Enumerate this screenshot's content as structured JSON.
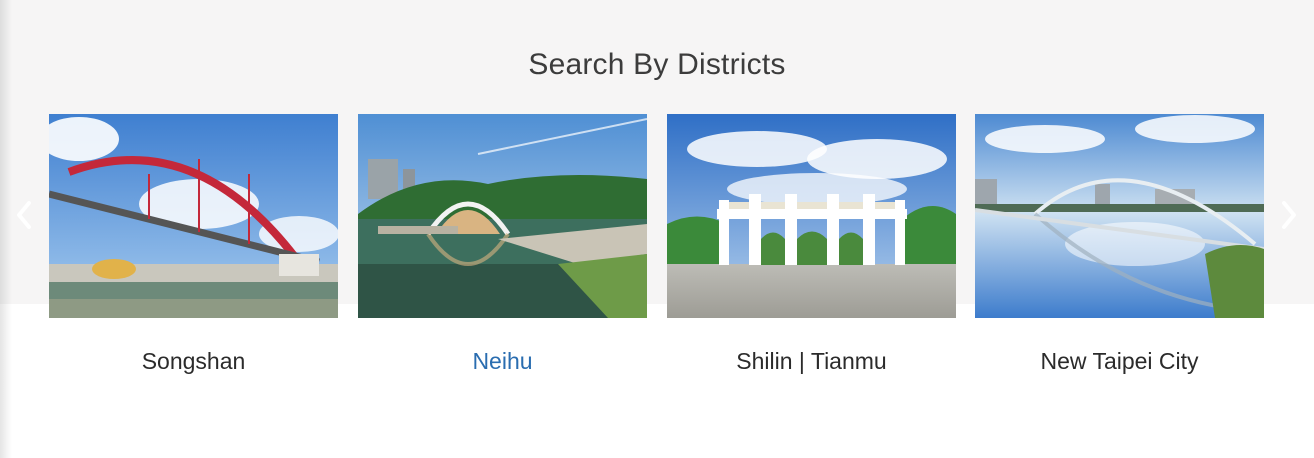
{
  "section": {
    "title": "Search By Districts"
  },
  "districts": [
    {
      "label": "Songshan"
    },
    {
      "label": "Neihu"
    },
    {
      "label": "Shilin | Tianmu"
    },
    {
      "label": "New Taipei City"
    }
  ],
  "carousel": {
    "prev_icon": "chevron-left-icon",
    "next_icon": "chevron-right-icon",
    "active_index": 1
  },
  "colors": {
    "band_bg": "#f6f5f5",
    "label": "#2b2b2b",
    "active_label": "#2a6db0",
    "title": "#3c3c3c"
  }
}
